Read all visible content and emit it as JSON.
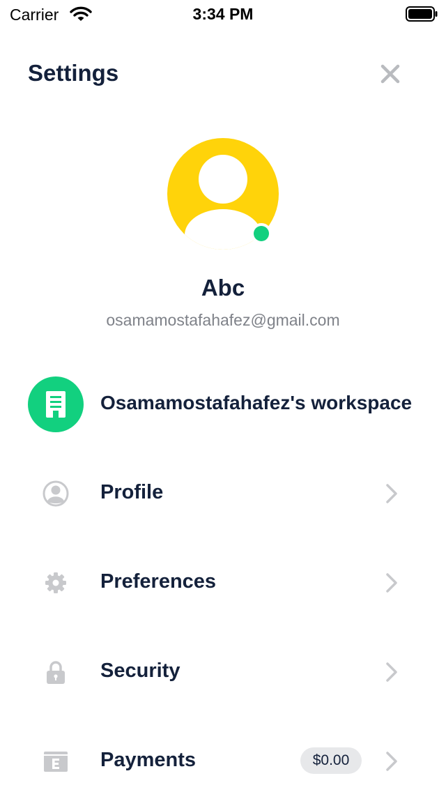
{
  "status_bar": {
    "carrier": "Carrier",
    "time": "3:34 PM"
  },
  "header": {
    "title": "Settings",
    "close_icon": "close-icon"
  },
  "user": {
    "name": "Abc",
    "email": "osamamostafahafez@gmail.com",
    "avatar_color": "#FFD30A",
    "online_color": "#12D07F"
  },
  "workspace": {
    "label": "Osamamostafahafez's workspace",
    "icon": "building-icon",
    "color": "#12D07F"
  },
  "menu": [
    {
      "label": "Profile",
      "icon": "user-circle-icon"
    },
    {
      "label": "Preferences",
      "icon": "gear-icon"
    },
    {
      "label": "Security",
      "icon": "lock-icon"
    },
    {
      "label": "Payments",
      "icon": "wallet-icon",
      "badge": "$0.00"
    }
  ],
  "colors": {
    "text": "#14213B",
    "muted": "#7F8289",
    "icon_gray": "#C8C9CC"
  }
}
